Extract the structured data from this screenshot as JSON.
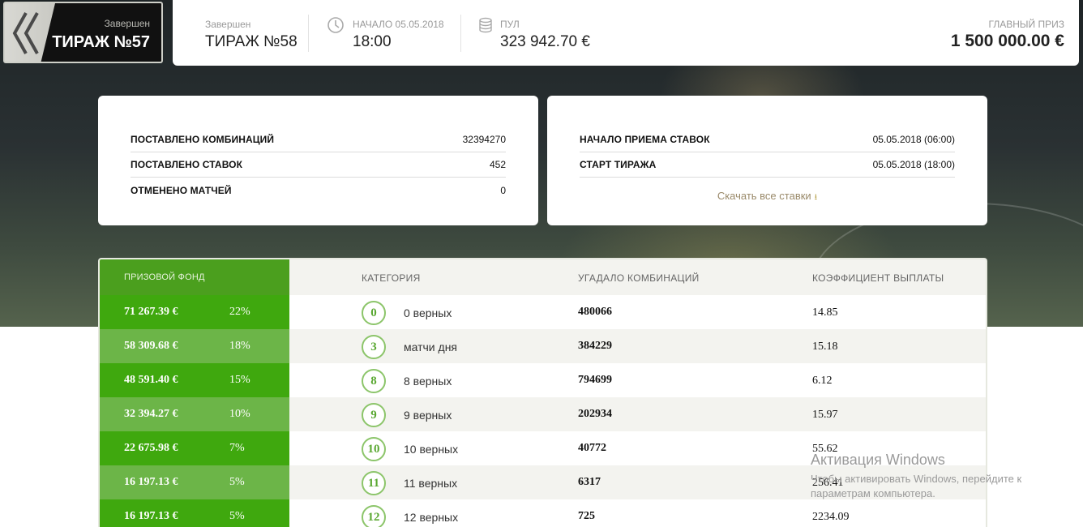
{
  "prev_draw": {
    "status": "Завершен",
    "title": "ТИРАЖ №57"
  },
  "topbar": {
    "current": {
      "status": "Завершен",
      "title": "ТИРАЖ №58"
    },
    "start": {
      "label": "НАЧАЛО 05.05.2018",
      "value": "18:00",
      "icon": "clock-icon"
    },
    "pool": {
      "label": "ПУЛ",
      "value": "323 942.70 €",
      "icon": "coins-icon"
    },
    "main_prize": {
      "label": "ГЛАВНЫЙ ПРИЗ",
      "value": "1 500 000.00 €"
    }
  },
  "stats_card": {
    "rows": [
      {
        "label": "ПОСТАВЛЕНО КОМБИНАЦИЙ",
        "value": "32394270"
      },
      {
        "label": "ПОСТАВЛЕНО СТАВОК",
        "value": "452"
      },
      {
        "label": "ОТМЕНЕНО МАТЧЕЙ",
        "value": "0"
      }
    ]
  },
  "schedule_card": {
    "rows": [
      {
        "label": "НАЧАЛО ПРИЕМА СТАВОК",
        "value": "05.05.2018 (06:00)"
      },
      {
        "label": "СТАРТ ТИРАЖА",
        "value": "05.05.2018 (18:00)"
      }
    ],
    "download_label": "Скачать все ставки",
    "download_icon": "download-icon"
  },
  "results": {
    "headers": {
      "fund": "ПРИЗОВОЙ ФОНД",
      "category": "КАТЕГОРИЯ",
      "combinations": "УГАДАЛО КОМБИНАЦИЙ",
      "coefficient": "КОЭФФИЦИЕНТ ВЫПЛАТЫ"
    },
    "rows": [
      {
        "amount": "71 267.39 €",
        "percent": "22%",
        "num": "0",
        "category": "0 верных",
        "combinations": "480066",
        "coefficient": "14.85"
      },
      {
        "amount": "58 309.68 €",
        "percent": "18%",
        "num": "3",
        "category": "матчи дня",
        "combinations": "384229",
        "coefficient": "15.18"
      },
      {
        "amount": "48 591.40 €",
        "percent": "15%",
        "num": "8",
        "category": "8 верных",
        "combinations": "794699",
        "coefficient": "6.12"
      },
      {
        "amount": "32 394.27 €",
        "percent": "10%",
        "num": "9",
        "category": "9 верных",
        "combinations": "202934",
        "coefficient": "15.97"
      },
      {
        "amount": "22 675.98 €",
        "percent": "7%",
        "num": "10",
        "category": "10 верных",
        "combinations": "40772",
        "coefficient": "55.62"
      },
      {
        "amount": "16 197.13 €",
        "percent": "5%",
        "num": "11",
        "category": "11 верных",
        "combinations": "6317",
        "coefficient": "256.41"
      },
      {
        "amount": "16 197.13 €",
        "percent": "5%",
        "num": "12",
        "category": "12 верных",
        "combinations": "725",
        "coefficient": "2234.09"
      }
    ]
  },
  "watermark": {
    "line1": "Активация Windows",
    "line2": "Чтобы активировать Windows, перейдите к параметрам компьютера."
  },
  "colors": {
    "fund_green_dark": "#3fa80e",
    "fund_green_light": "#6cb548",
    "circle_border": "#8cc56a"
  }
}
